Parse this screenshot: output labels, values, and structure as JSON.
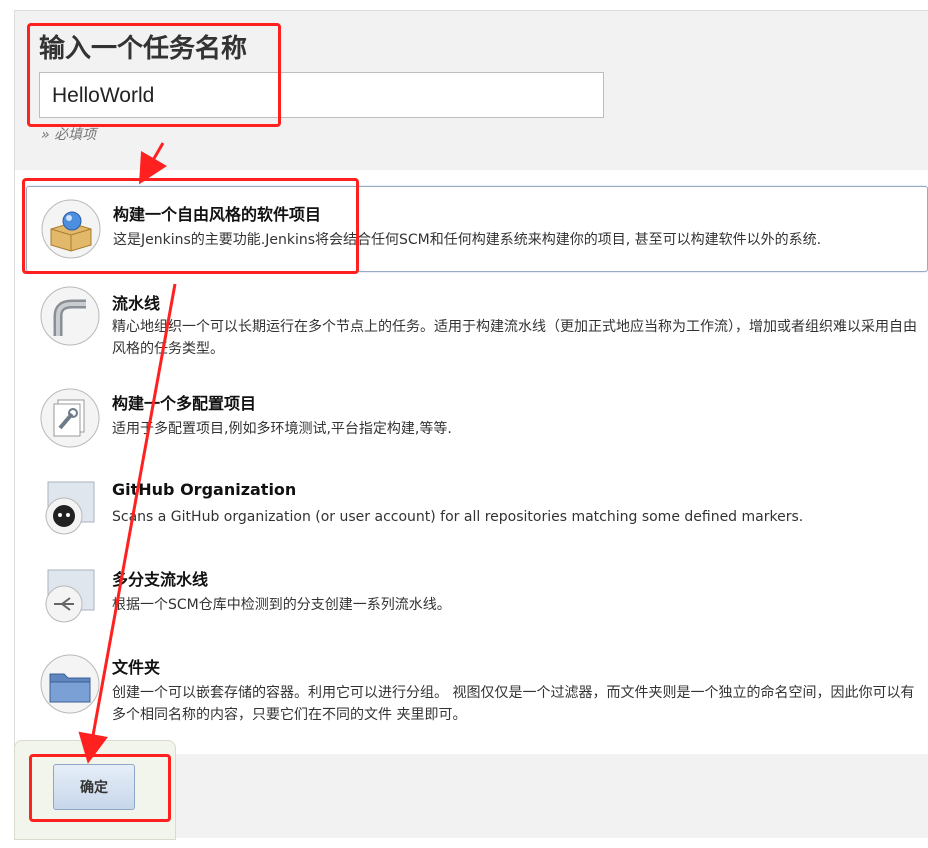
{
  "form": {
    "title": "输入一个任务名称",
    "name_value": "HelloWorld",
    "required_note": "» 必填项"
  },
  "items": [
    {
      "title": "构建一个自由风格的软件项目",
      "desc": "这是Jenkins的主要功能.Jenkins将会结合任何SCM和任何构建系统来构建你的项目, 甚至可以构建软件以外的系统.",
      "icon": "freestyle-box-icon"
    },
    {
      "title": "流水线",
      "desc": "精心地组织一个可以长期运行在多个节点上的任务。适用于构建流水线（更加正式地应当称为工作流），增加或者组织难以采用自由风格的任务类型。",
      "icon": "pipeline-icon"
    },
    {
      "title": "构建一个多配置项目",
      "desc": "适用于多配置项目,例如多环境测试,平台指定构建,等等.",
      "icon": "multi-config-icon"
    },
    {
      "title": "GitHub Organization",
      "desc": "Scans a GitHub organization (or user account) for all repositories matching some defined markers.",
      "icon": "github-icon"
    },
    {
      "title": "多分支流水线",
      "desc": "根据一个SCM仓库中检测到的分支创建一系列流水线。",
      "icon": "multibranch-icon"
    },
    {
      "title": "文件夹",
      "desc": "创建一个可以嵌套存储的容器。利用它可以进行分组。 视图仅仅是一个过滤器，而文件夹则是一个独立的命名空间，因此你可以有多个相同名称的内容，只要它们在不同的文件 夹里即可。",
      "icon": "folder-icon"
    }
  ],
  "footer": {
    "ok_label": "确定"
  },
  "annotation_color": "#ff2020"
}
